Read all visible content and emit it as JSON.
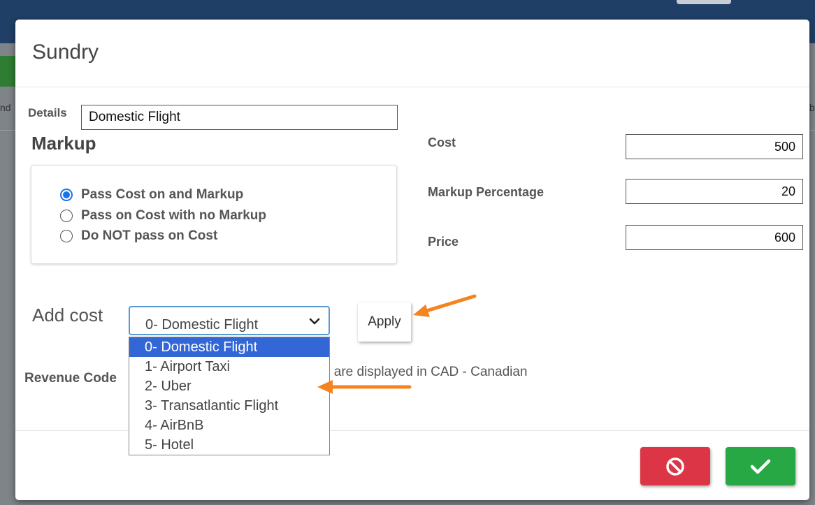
{
  "background": {
    "fragments": [
      "nd",
      "b"
    ]
  },
  "modal": {
    "title": "Sundry",
    "details": {
      "label": "Details",
      "value": "Domestic Flight"
    },
    "markup": {
      "title": "Markup",
      "options": [
        {
          "label": "Pass Cost on and Markup",
          "checked": true
        },
        {
          "label": "Pass on Cost with no Markup",
          "checked": false
        },
        {
          "label": "Do NOT pass on Cost",
          "checked": false
        }
      ]
    },
    "cost": {
      "label": "Cost",
      "value": "500"
    },
    "markup_percentage": {
      "label": "Markup Percentage",
      "value": "20"
    },
    "price": {
      "label": "Price",
      "value": "600"
    },
    "add_cost": {
      "label": "Add cost",
      "selected": "0- Domestic Flight",
      "options": [
        "0- Domestic Flight",
        "1- Airport Taxi",
        "2- Uber",
        "3- Transatlantic Flight",
        "4- AirBnB",
        "5- Hotel"
      ],
      "apply_label": "Apply"
    },
    "revenue_code": {
      "label": "Revenue Code"
    },
    "currency_note": "s are displayed in CAD - Canadian"
  },
  "colors": {
    "primary": "#1a73e8",
    "danger": "#dc3545",
    "success": "#28a745",
    "annotation_arrow": "#f5841f",
    "selected_option": "#3367d6"
  },
  "icons": {
    "cancel": "ban-icon",
    "confirm": "check-icon",
    "dropdown": "chevron-down-icon"
  }
}
